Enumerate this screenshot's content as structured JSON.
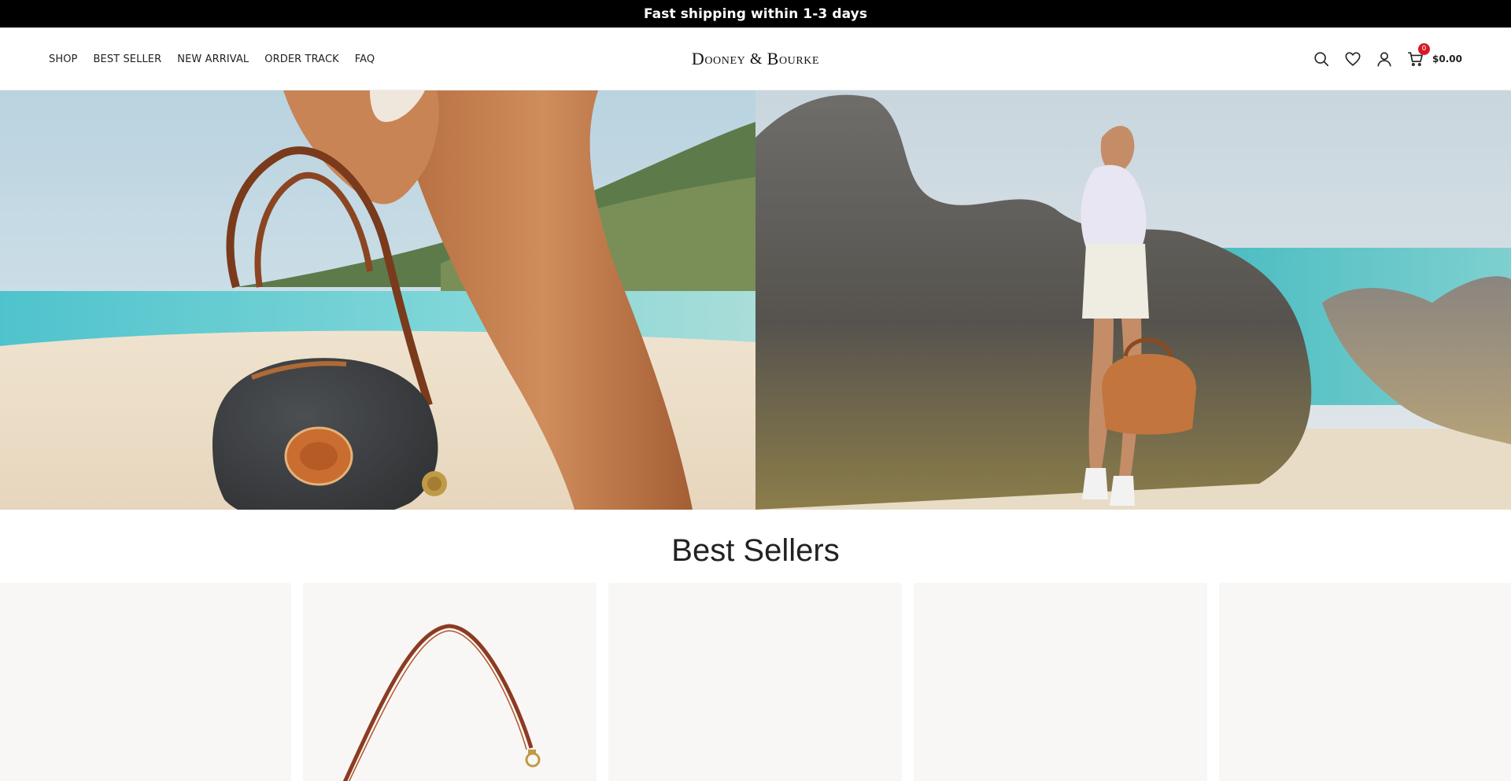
{
  "announcement": {
    "text": "Fast shipping within 1-3 days"
  },
  "header": {
    "nav": [
      {
        "label": "SHOP"
      },
      {
        "label": "BEST SELLER"
      },
      {
        "label": "NEW ARRIVAL"
      },
      {
        "label": "ORDER TRACK"
      },
      {
        "label": "FAQ"
      }
    ],
    "logo": {
      "part1_initial": "D",
      "part1_rest": "ooney",
      "amp": " & ",
      "part2_initial": "B",
      "part2_rest": "ourke"
    },
    "tools": {
      "search_icon": "search-icon",
      "wishlist_icon": "heart-icon",
      "account_icon": "user-icon",
      "cart_icon": "cart-icon",
      "cart_count": "0",
      "cart_total": "$0.00"
    }
  },
  "hero": {
    "left_panel": "handbag-on-beach-photo",
    "right_panel": "woman-with-bag-by-rocks-photo"
  },
  "best_sellers": {
    "title": "Best Sellers",
    "cards": [
      {
        "image": "product-image-empty"
      },
      {
        "image": "product-image-shoulder-strap-bag"
      },
      {
        "image": "product-image-empty"
      },
      {
        "image": "product-image-empty"
      },
      {
        "image": "product-image-empty"
      }
    ]
  },
  "colors": {
    "announcement_bg": "#000000",
    "badge": "#d6182a",
    "card_bg": "#f8f7f5"
  }
}
